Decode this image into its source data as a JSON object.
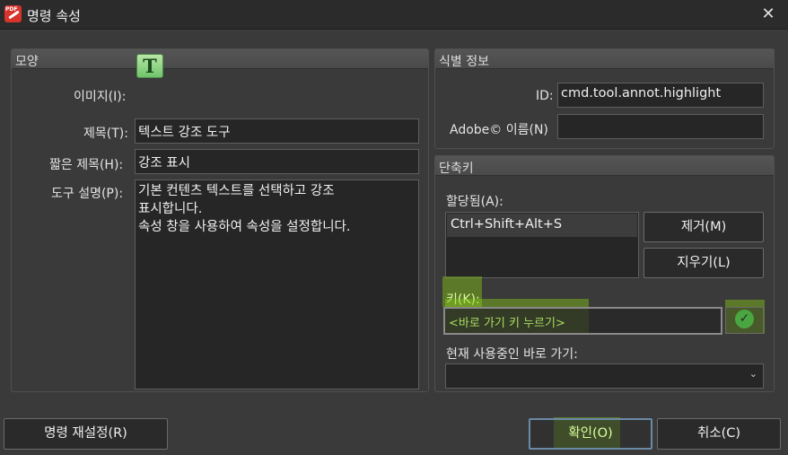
{
  "window": {
    "title": "명령 속성",
    "close_icon": "close-icon",
    "app_icon": "pdf-pen-icon",
    "app_icon_text": "PDF"
  },
  "appearance": {
    "header": "모양",
    "image_label": "이미지(I):",
    "image_icon_glyph": "T",
    "title_label": "제목(T):",
    "title_value": "텍스트 강조 도구",
    "short_title_label": "짧은 제목(H):",
    "short_title_value": "강조 표시",
    "desc_label": "도구 설명(P):",
    "desc_value": "기본 컨텐츠 텍스트를 선택하고 강조\n표시합니다.\n속성 창을 사용하여 속성을 설정합니다."
  },
  "identity": {
    "header": "식별 정보",
    "id_label": "ID:",
    "id_value": "cmd.tool.annot.highlight",
    "adobe_label": "Adobe© 이름(N)",
    "adobe_value": ""
  },
  "shortcut": {
    "header": "단축키",
    "assigned_label": "할당됨(A):",
    "assigned_items": [
      "Ctrl+Shift+Alt+S"
    ],
    "remove_button": "제거(M)",
    "clear_button": "지우기(L)",
    "key_label": "키(K):",
    "key_placeholder": "<바로 가기 키 누르기>",
    "current_label": "현재 사용중인 바로 가기:",
    "current_value": ""
  },
  "footer": {
    "reset_button": "명령 재설정(R)",
    "ok_button": "확인(O)",
    "cancel_button": "취소(C)"
  },
  "colors": {
    "highlight": "#88c818",
    "accent_border": "#6b8aa5",
    "icon_green": "#6fc46b"
  }
}
